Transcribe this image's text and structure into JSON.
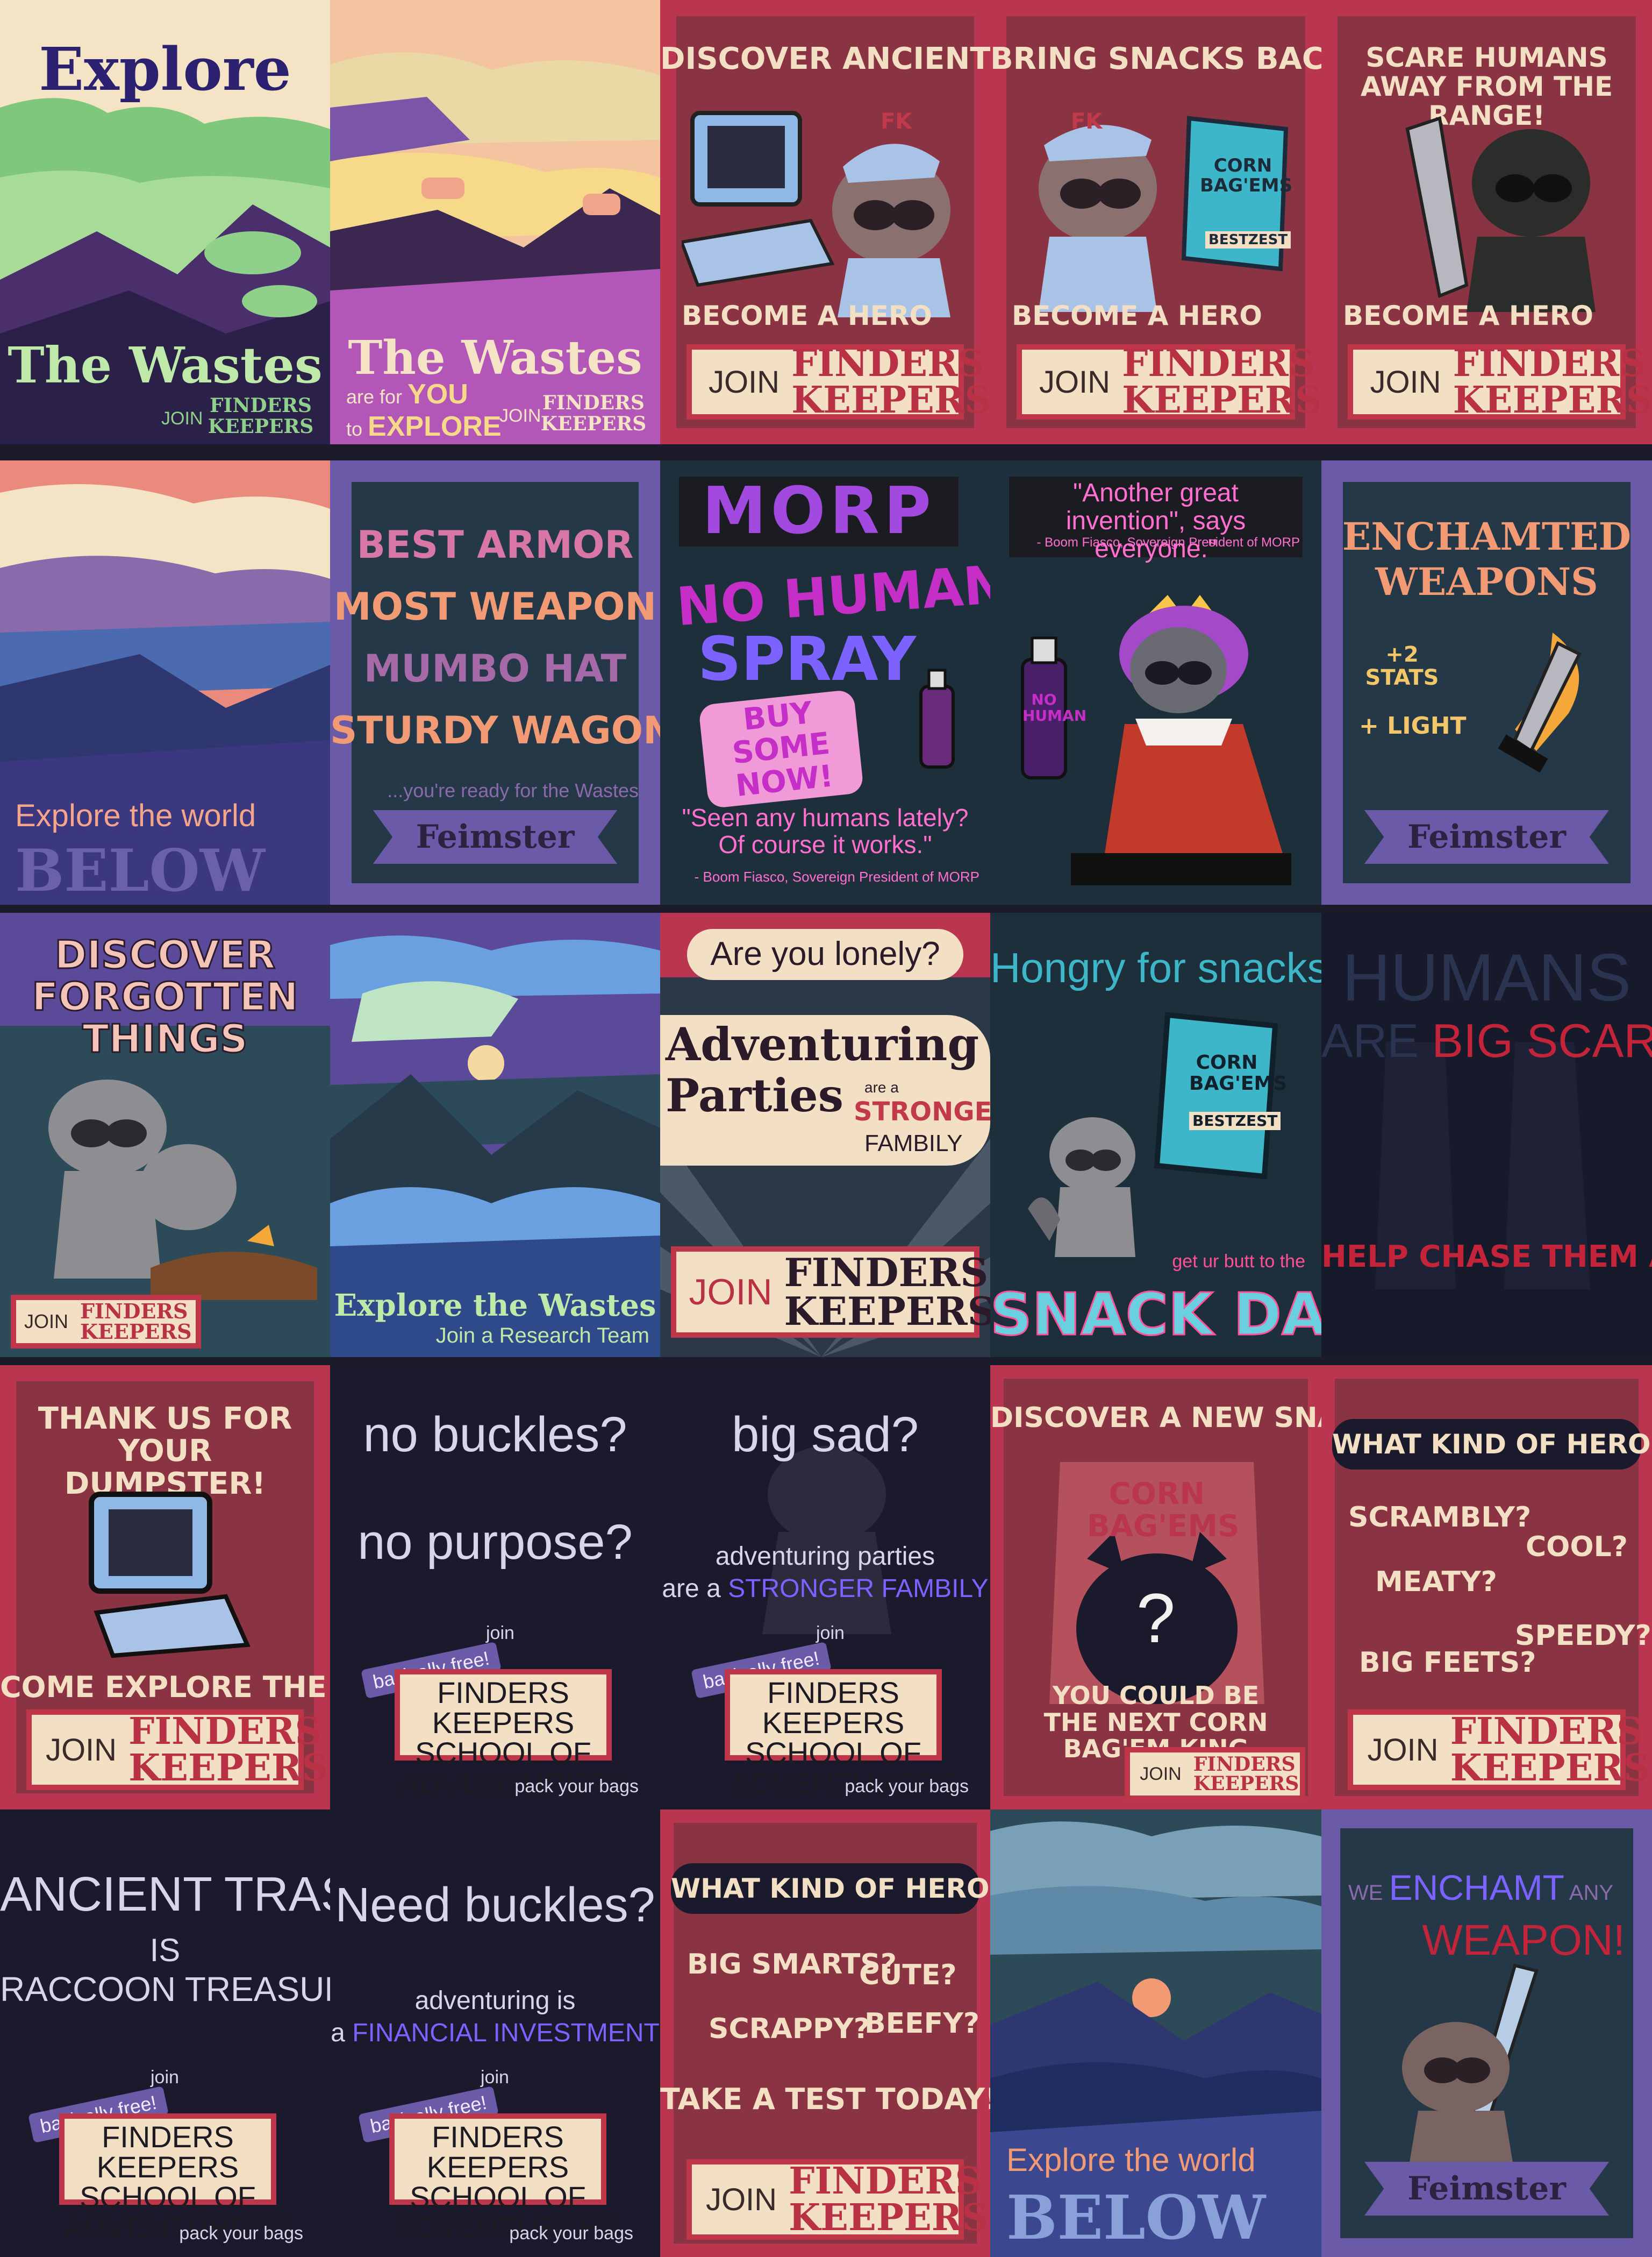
{
  "posters": {
    "p01": {
      "title": "Explore",
      "bottom": "The Wastes",
      "join": "JOIN",
      "fk": "FINDERS KEEPERS"
    },
    "p02": {
      "title": "The Wastes",
      "line1_a": "are for",
      "line1_b": "YOU",
      "line2_a": "to",
      "line2_b": "EXPLORE",
      "join": "JOIN",
      "fk": "FINDERS KEEPERS"
    },
    "p03": {
      "title": "DISCOVER ANCIENT TRASH",
      "cap_badge": "FK",
      "tag": "BECOME A HERO",
      "join": "JOIN",
      "fk": "FINDERS KEEPERS"
    },
    "p04": {
      "title": "BRING SNACKS BACK",
      "cap_badge": "FK",
      "bag_top": "CORN BAG'EMS",
      "bag_label": "BESTZEST",
      "tag": "BECOME A HERO",
      "join": "JOIN",
      "fk": "FINDERS KEEPERS"
    },
    "p05": {
      "title": "SCARE HUMANS AWAY FROM THE RANGE!",
      "tag": "BECOME A HERO",
      "join": "JOIN",
      "fk": "FINDERS KEEPERS"
    },
    "p06": {
      "line": "Explore the world",
      "big": "BELOW"
    },
    "p07": {
      "items": [
        "BEST ARMOR",
        "MOST WEAPON",
        "MUMBO HAT",
        "STURDY WAGONS"
      ],
      "sub": "...you're ready for the Wastes",
      "brand": "Feimster"
    },
    "p08": {
      "logo": "MORP",
      "spray_a": "NO HUMAN",
      "spray_b": "SPRAY",
      "buy": "BUY SOME NOW!",
      "quote": "\"Seen any humans lately? Of course it works.\"",
      "attr": "- Boom Fiasco, Sovereign President of MORP"
    },
    "p09": {
      "quote": "\"Another great invention\", says everyone.\"",
      "attr": "- Boom Fiasco, Sovereign President of MORP",
      "can_label": "NO HUMAN"
    },
    "p10": {
      "title": "ENCHAMTED WEAPONS",
      "stat": "+2 STATS",
      "light": "+ LIGHT",
      "brand": "Feimster"
    },
    "p11": {
      "title": "DISCOVER FORGOTTEN THINGS",
      "join": "JOIN",
      "fk": "FINDERS KEEPERS"
    },
    "p12": {
      "title": "Explore the Wastes",
      "sub": "Join a Research Team"
    },
    "p13": {
      "q": "Are you lonely?",
      "big1": "Adventuring",
      "big2": "Parties",
      "are": "are a",
      "stronger": "STRONGER",
      "fambily": "FAMBILY",
      "join": "JOIN",
      "fk": "FINDERS KEEPERS"
    },
    "p14": {
      "title": "Hongry for snacks?",
      "bag_top": "CORN BAG'EMS",
      "bag_label": "BESTZEST",
      "small": "get ur butt to the",
      "big": "SNACK DANDY"
    },
    "p15": {
      "a": "HUMANS",
      "b": "ARE",
      "c": "BIG SCARY",
      "foot": "HELP CHASE THEM AWAY"
    },
    "p16": {
      "title": "THANK US FOR YOUR DUMPSTER!",
      "tag": "COME EXPLORE THE WASTES",
      "join": "JOIN",
      "fk": "FINDERS KEEPERS"
    },
    "p17": {
      "a": "no buckles?",
      "b": "no purpose?",
      "join_small": "join",
      "badge": "basically free!",
      "school": "FINDERS KEEPERS SCHOOL OF ADVENTURERS",
      "pack": "pack your bags"
    },
    "p18": {
      "a": "big sad?",
      "b": "adventuring parties",
      "c_a": "are a",
      "c_b": "STRONGER FAMBILY",
      "join_small": "join",
      "badge": "basically free!",
      "school": "FINDERS KEEPERS SCHOOL OF ADVENTURERS",
      "pack": "pack your bags"
    },
    "p19": {
      "title": "DISCOVER A NEW SNACK?",
      "bag": "CORN BAG'EMS",
      "mark": "?",
      "foot": "YOU COULD BE THE NEXT CORN BAG'EM KING",
      "join": "JOIN",
      "fk": "FINDERS KEEPERS"
    },
    "p20": {
      "title": "WHAT KIND OF HERO ARE YOU",
      "opts": [
        "SCRAMBLY?",
        "COOL?",
        "MEATY?",
        "SPEEDY?",
        "BIG FEETS?"
      ],
      "join": "JOIN",
      "fk": "FINDERS KEEPERS"
    },
    "p21": {
      "a": "ANCIENT TRASH",
      "b": "IS",
      "c": "RACCOON TREASURE",
      "join_small": "join",
      "badge": "basically free!",
      "school": "FINDERS KEEPERS SCHOOL OF ADVENTURERS",
      "pack": "pack your bags"
    },
    "p22": {
      "a": "Need buckles?",
      "b": "adventuring is",
      "c_a": "a",
      "c_b": "FINANCIAL INVESTMENT",
      "join_small": "join",
      "badge": "basically free!",
      "school": "FINDERS KEEPERS SCHOOL OF ADVENTURERS",
      "pack": "pack your bags"
    },
    "p23": {
      "title": "WHAT KIND OF HERO ARE YOU",
      "opts": [
        "BIG SMARTS?",
        "CUTE?",
        "SCRAPPY?",
        "BEEFY?"
      ],
      "test": "TAKE A TEST TODAY!",
      "join": "JOIN",
      "fk": "FINDERS KEEPERS"
    },
    "p24": {
      "line": "Explore the world",
      "big": "BELOW"
    },
    "p25": {
      "we": "WE",
      "ench": "ENCHAMT",
      "any": "ANY",
      "weapon": "WEAPON!",
      "brand": "Feimster"
    }
  }
}
